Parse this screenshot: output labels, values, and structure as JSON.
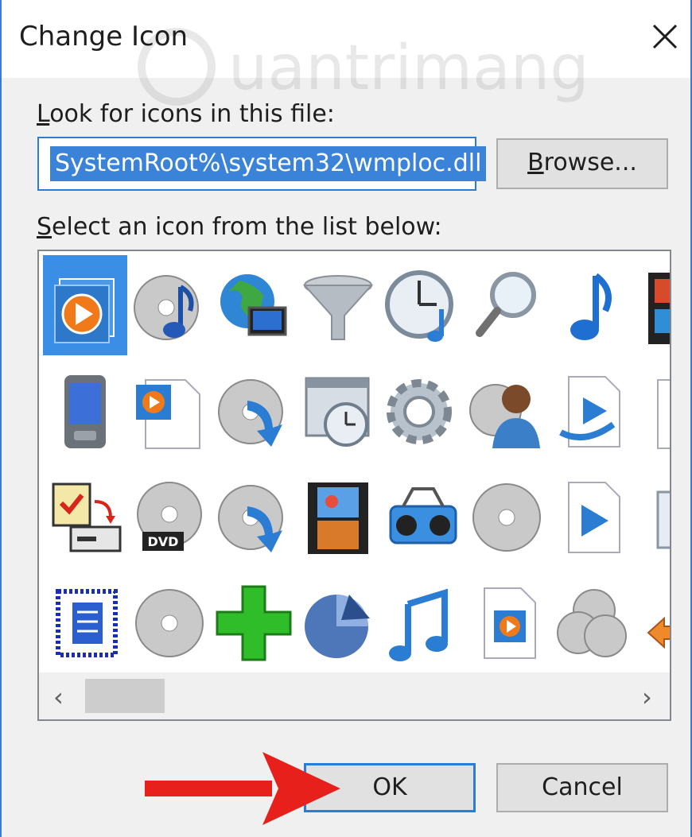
{
  "window": {
    "title": "Change Icon",
    "close_icon": "close-icon",
    "watermark": "Quantrimang"
  },
  "file_label": {
    "pre": "",
    "u": "L",
    "post": "ook for icons in this file:"
  },
  "file_path": "SystemRoot%\\system32\\wmploc.dll",
  "browse": {
    "u": "B",
    "post": "rowse..."
  },
  "list_label": {
    "u": "S",
    "post": "elect an icon from the list below:"
  },
  "icons": [
    "media-player-icon",
    "cd-music-icon",
    "network-globe-icon",
    "funnel-icon",
    "clock-music-icon",
    "magnifier-icon",
    "music-note-icon",
    "film-strip-icon",
    "mobile-device-icon",
    "media-file-icon",
    "cd-burn-icon",
    "calendar-clock-icon",
    "gear-icon",
    "cd-user-icon",
    "play-document-icon",
    "partial-document-icon",
    "checklist-sync-icon",
    "dvd-icon",
    "cd-download-icon",
    "film-photo-icon",
    "boombox-icon",
    "cd-icon",
    "play-file-icon",
    "partial-window-icon",
    "document-list-icon",
    "cd-plain-icon",
    "green-plus-icon",
    "pie-chart-icon",
    "music-notes-icon",
    "media-play-file-icon",
    "multi-cd-icon",
    "orange-arrow-icon"
  ],
  "scrollbar": {
    "left_arrow": "‹",
    "right_arrow": "›"
  },
  "ok_label": "OK",
  "cancel_label": "Cancel",
  "colors": {
    "accent": "#2b7cd3",
    "selection": "#3b8ee6",
    "arrow": "#e8201c"
  }
}
